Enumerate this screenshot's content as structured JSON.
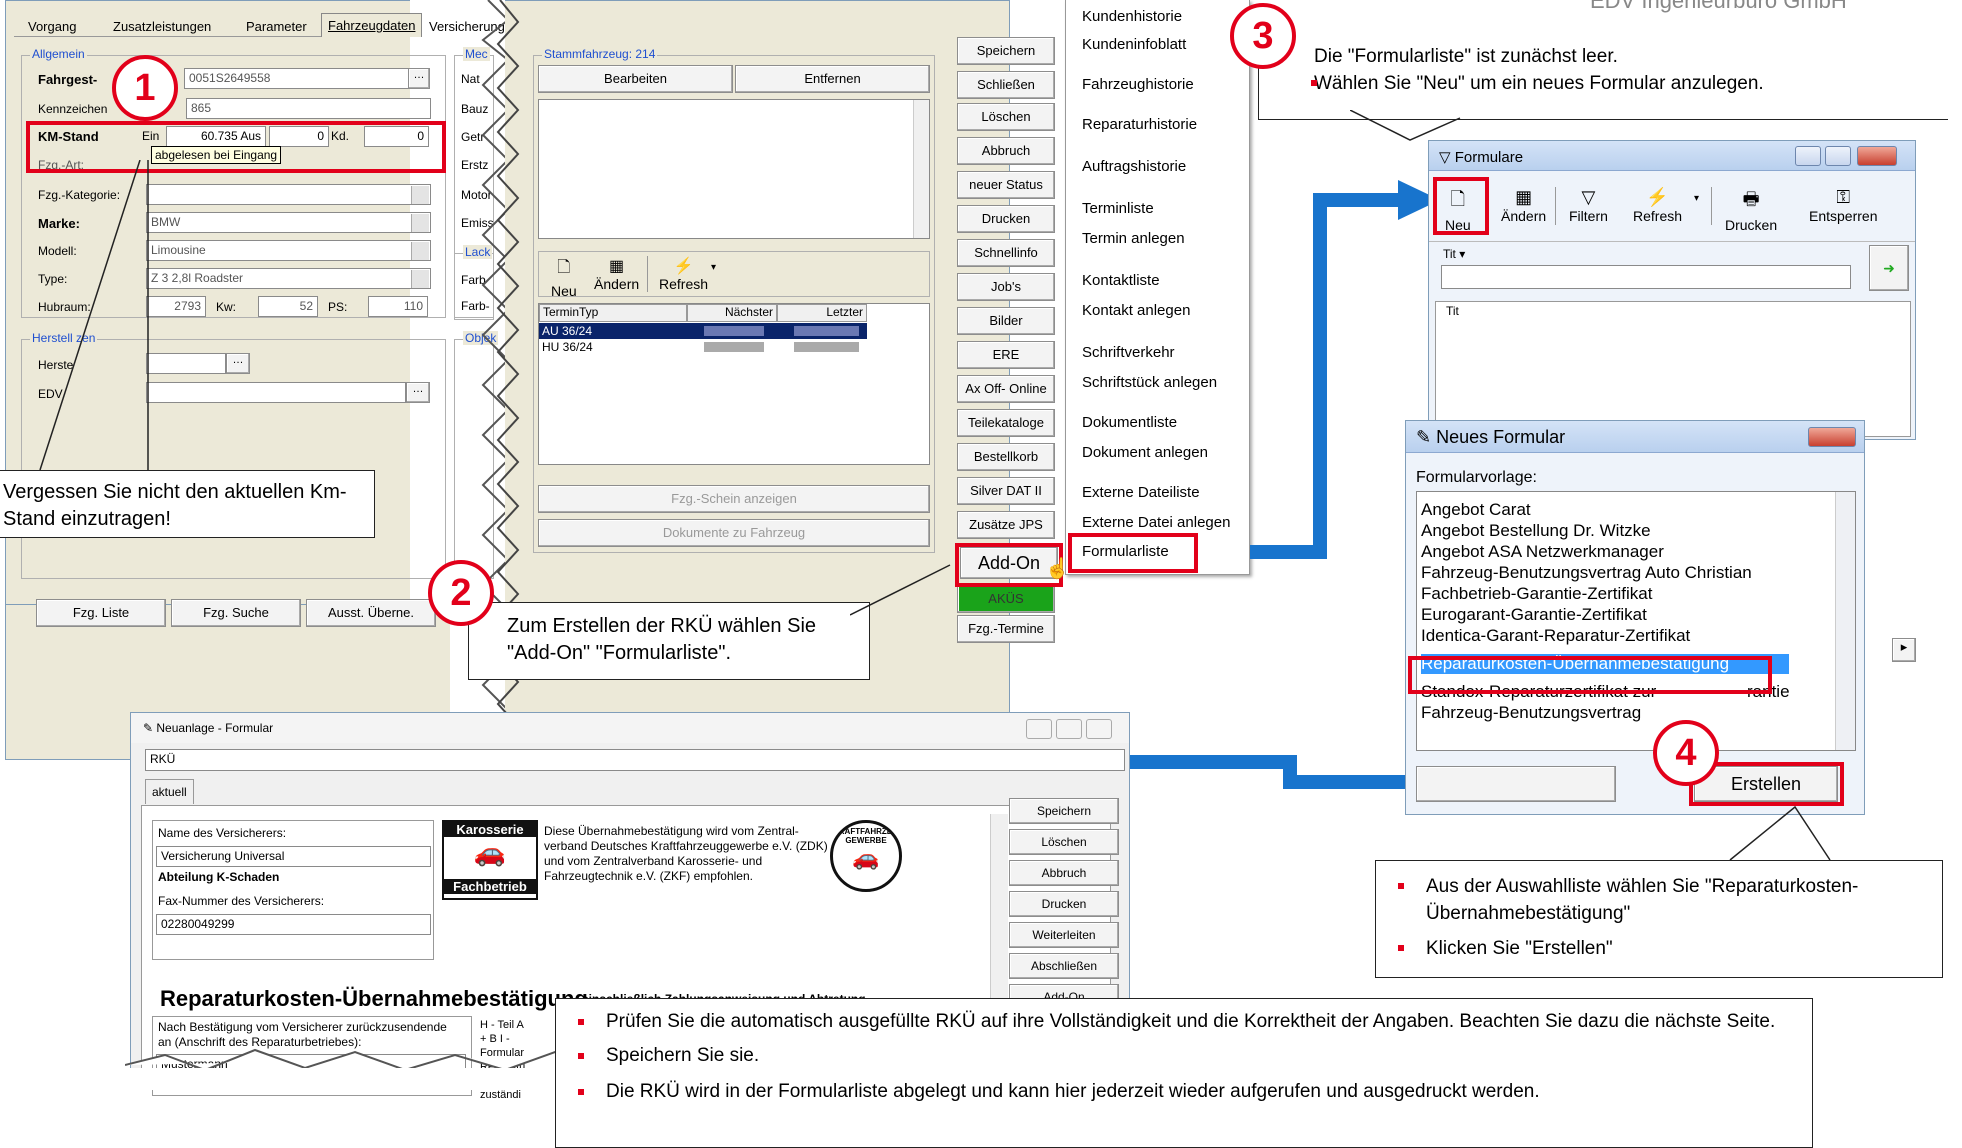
{
  "corner_text": "EDV Ingenieurbüro GmbH",
  "main_window": {
    "tabs": [
      "Vorgang",
      "Zusatzleistungen",
      "Parameter",
      "Fahrzeugdaten",
      "Versicherung"
    ],
    "group_allgemein": "Allgemein",
    "fahrgest_label": "Fahrgest-",
    "fahrgest_value": "0051S2649558",
    "kennzeichen_label": "Kennzeichen",
    "kennzeichen_value": "865",
    "km_label": "KM-Stand",
    "km_ein": "Ein",
    "km_value": "60.735",
    "km_aus_label": "Aus",
    "km_aus_value": "0",
    "km_kd_label": "Kd.",
    "km_kd_value": "0",
    "tooltip": "abgelesen bei Eingang",
    "fzg_art": "Fzg.-Art:",
    "fzg_kategorie": "Fzg.-Kategorie:",
    "marke_label": "Marke:",
    "marke_value": "BMW",
    "modell_label": "Modell:",
    "modell_value": "Limousine",
    "type_label": "Type:",
    "type_value": "Z 3 2,8l Roadster",
    "hubraum_label": "Hubraum:",
    "hubraum_value": "2793",
    "kw_label": "Kw:",
    "kw_value": "52",
    "ps_label": "PS:",
    "ps_value": "110",
    "group_hersteller": "Herstell",
    "group_hersteller_suffix": "zen",
    "herste_label": "Herste",
    "edv_label": "EDV",
    "col2_labels": [
      "Nat",
      "Bauz",
      "Getr",
      "Erstz",
      "Motor",
      "Emiss"
    ],
    "col2_group": "Mec",
    "lack_group": "Lack",
    "lack_labels": [
      "Farb",
      "Farb-"
    ],
    "objek_group": "Objek",
    "bottom_buttons": [
      "Fzg. Liste",
      "Fzg. Suche",
      "Ausst. Überne."
    ]
  },
  "middle_window": {
    "stamm_group": "Stammfahrzeug: 214",
    "bearbeiten": "Bearbeiten",
    "entfernen": "Entfernen",
    "tb_neu": "Neu",
    "tb_aendern": "Ändern",
    "tb_refresh": "Refresh",
    "table_headers": [
      "TerminTyp",
      "Nächster",
      "Letzter"
    ],
    "rows": [
      "AU 36/24",
      "HU 36/24"
    ],
    "schein_btn": "Fzg.-Schein anzeigen",
    "dokumente_btn": "Dokumente zu Fahrzeug"
  },
  "right_buttons": [
    "Speichern",
    "Schließen",
    "Löschen",
    "Abbruch",
    "neuer Status",
    "Drucken",
    "Schnellinfo",
    "Job's",
    "Bilder",
    "ERE",
    "Ax Off- Online",
    "Teilekataloge",
    "Bestellkorb",
    "Silver DAT II",
    "Zusätze JPS",
    "Add-On",
    "AKÜS",
    "Fzg.-Termine"
  ],
  "menu_items": [
    "Kundenhistorie",
    "Kundeninfoblatt",
    "Fahrzeughistorie",
    "Reparaturhistorie",
    "Auftragshistorie",
    "Terminliste",
    "Termin anlegen",
    "Kontaktliste",
    "Kontakt anlegen",
    "Schriftverkehr",
    "Schriftstück anlegen",
    "Dokumentliste",
    "Dokument anlegen",
    "Externe Dateiliste",
    "Externe Datei anlegen",
    "Formularliste"
  ],
  "callouts": {
    "c1": "Vergessen Sie nicht den aktuellen Km-Stand einzutragen!",
    "c2": "Zum Erstellen der RKÜ wählen Sie \"Add-On\" \"Formularliste\".",
    "c3_line1": "Die \"Formularliste\" ist zunächst leer.",
    "c3_line2": "Wählen Sie \"Neu\" um ein neues Formular anzulegen.",
    "c4_line1": "Aus der Auswahlliste wählen Sie \"Reparaturkosten-Übernahmebestätigung\"",
    "c4_line2": "Klicken Sie \"Erstellen\"",
    "c5_line1": "Prüfen Sie die automatisch ausgefüllte RKÜ auf ihre Vollständigkeit und die Korrektheit der Angaben. Beachten Sie dazu die nächste Seite.",
    "c5_line2": "Speichern Sie sie.",
    "c5_line3": "Die RKÜ wird in der Formularliste abgelegt und kann hier jederzeit wieder aufgerufen und ausgedruckt werden."
  },
  "steps": [
    "1",
    "2",
    "3",
    "4"
  ],
  "formulare": {
    "title": "Formulare",
    "tb": [
      "Neu",
      "Ändern",
      "Filtern",
      "Refresh",
      "Drucken",
      "Entsperren"
    ],
    "titel_label": "Tit",
    "list_header": "Tit"
  },
  "neues_formular": {
    "title": "Neues Formular",
    "label": "Formularvorlage:",
    "items": [
      "Angebot Carat",
      "Angebot Bestellung Dr. Witzke",
      "Angebot ASA Netzwerkmanager",
      "Fahrzeug-Benutzungsvertrag Auto Christian",
      "Fachbetrieb-Garantie-Zertifikat",
      "Eurogarant-Garantie-Zertifikat",
      "Identica-Garant-Reparatur-Zertifikat",
      "Reparaturkosten-Übernahmebestätigung",
      "Standox-Reparaturzertifikat zur",
      "Fahrzeug-Benutzungsvertrag"
    ],
    "standox_suffix": "rantie",
    "erstellen": "Erstellen"
  },
  "neuanlage": {
    "title": "Neuanlage - Formular",
    "name_field": "RKÜ",
    "tab": "aktuell",
    "versicherer_label": "Name des Versicherers:",
    "versicherer_value": "Versicherung Universal",
    "abteilung": "Abteilung K-Schaden",
    "fax_label": "Fax-Nummer des Versicherers:",
    "fax_value": "02280049299",
    "logo_top": "Karosserie",
    "logo_bottom": "Fachbetrieb",
    "desc": "Diese Übernahmebestätigung wird vom Zentral-verband Deutsches Kraftfahrzeuggewerbe e.V. (ZDK) und vom Zentralverband Karosserie- und Fahrzeugtechnik e.V. (ZKF) empfohlen.",
    "seal": "KRAFTFAHRZEUG GEWERBE",
    "heading": "Reparaturkosten-Übernahmebestätigung",
    "subheading": "einschließlich Zahlungsanweisung und Abtretung",
    "return_label": "Nach Bestätigung vom Versicherer zurückzusendende an (Anschrift des Reparaturbetriebes):",
    "return_value": "Mustermann",
    "side_text": "H - Teil A + B I - Formular Reparatu N zuständi",
    "buttons": [
      "Speichern",
      "Löschen",
      "Abbruch",
      "Drucken",
      "Weiterleiten",
      "Abschließen",
      "Add-On"
    ]
  },
  "colors": {
    "accent_red": "#e2001a",
    "arrow_blue": "#1874cd",
    "selection": "#0a246a"
  }
}
